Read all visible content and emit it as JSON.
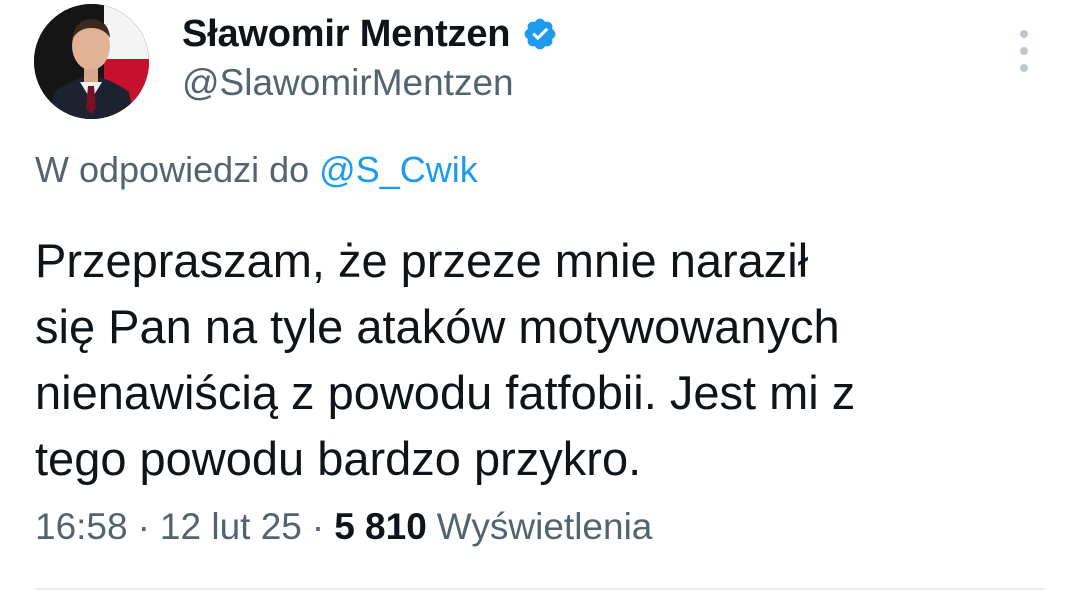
{
  "author": {
    "display_name": "Sławomir Mentzen",
    "handle": "@SlawomirMentzen",
    "verified": true,
    "verified_color": "#1d9bf0"
  },
  "reply": {
    "prefix": "W odpowiedzi do",
    "to_handle": "@S_Cwik"
  },
  "tweet": {
    "text": "Przepraszam, że przeze mnie naraził\nsię Pan na tyle ataków motywowanych\nnienawiścią z powodu fatfobii. Jest mi z\ntego powodu bardzo przykro."
  },
  "meta": {
    "time": "16:58",
    "separator": "·",
    "date": "12 lut 25",
    "views_count": "5 810",
    "views_label": "Wyświetlenia"
  },
  "icons": {
    "more": "more-vertical-icon",
    "verified": "verified-badge-icon"
  },
  "colors": {
    "text_primary": "#0f1419",
    "text_secondary": "#536471",
    "link": "#1d9bf0"
  }
}
